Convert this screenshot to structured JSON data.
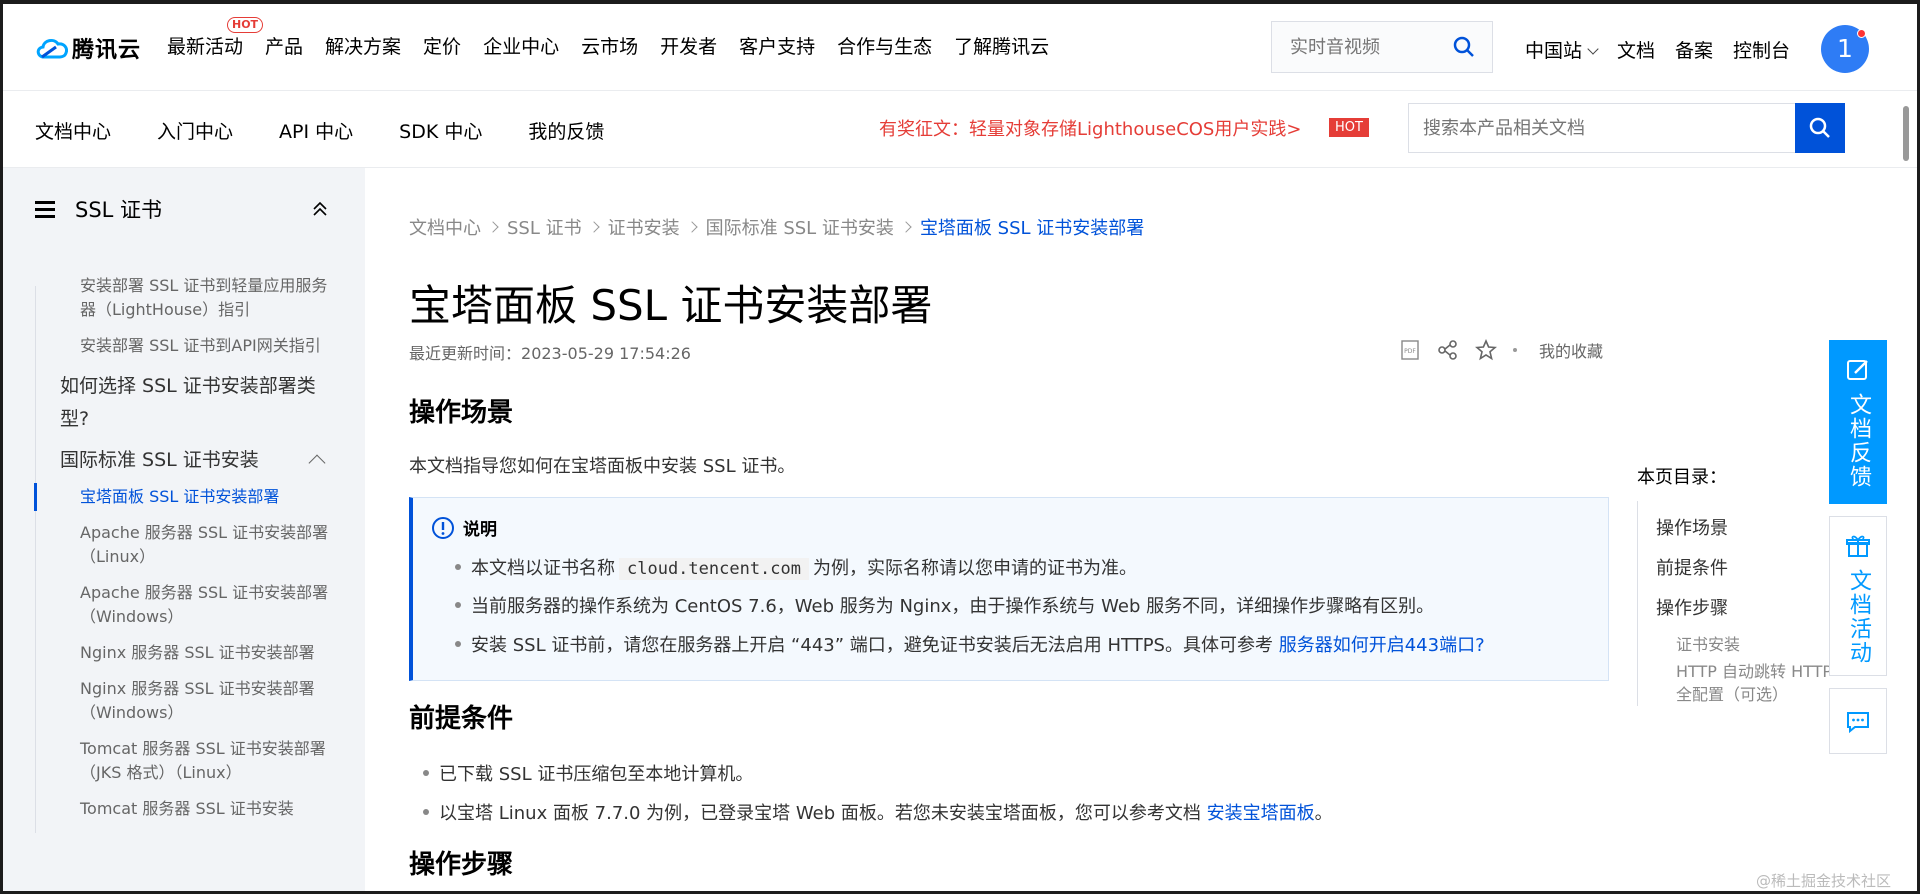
{
  "brand": {
    "name": "腾讯云",
    "color": "#0052d9",
    "logo_icon": "cloud-logo-icon"
  },
  "topnav": {
    "items": [
      "最新活动",
      "产品",
      "解决方案",
      "定价",
      "企业中心",
      "云市场",
      "开发者",
      "客户支持",
      "合作与生态",
      "了解腾讯云"
    ],
    "hot_badge": "HOT",
    "search_placeholder": "实时音视频",
    "right_items": [
      "中国站",
      "文档",
      "备案",
      "控制台"
    ],
    "avatar_text": "1"
  },
  "subnav": {
    "tabs": [
      "文档中心",
      "入门中心",
      "API 中心",
      "SDK 中心",
      "我的反馈"
    ],
    "promo_text": "有奖征文：轻量对象存储LighthouseCOS用户实践>",
    "promo_badge": "HOT",
    "search_placeholder": "搜索本产品相关文档"
  },
  "sidebar": {
    "title": "SSL 证书",
    "items": [
      {
        "label": "安装部署 SSL 证书到轻量应用服务器（LightHouse）指引",
        "level": 3
      },
      {
        "label": "安装部署 SSL 证书到API网关指引",
        "level": 3
      },
      {
        "label": "如何选择 SSL 证书安装部署类型?",
        "level": 2
      },
      {
        "label": "国际标准 SSL 证书安装",
        "level": 2
      },
      {
        "label": "宝塔面板 SSL 证书安装部署",
        "level": 3,
        "active": true
      },
      {
        "label": "Apache 服务器 SSL 证书安装部署（Linux）",
        "level": 3
      },
      {
        "label": "Apache 服务器 SSL 证书安装部署（Windows）",
        "level": 3
      },
      {
        "label": "Nginx 服务器 SSL 证书安装部署",
        "level": 3
      },
      {
        "label": "Nginx 服务器 SSL 证书安装部署（Windows）",
        "level": 3
      },
      {
        "label": "Tomcat 服务器 SSL 证书安装部署（JKS 格式）（Linux）",
        "level": 3
      },
      {
        "label": "Tomcat 服务器 SSL 证书安装",
        "level": 3
      }
    ]
  },
  "breadcrumb": [
    "文档中心",
    "SSL 证书",
    "证书安装",
    "国际标准 SSL 证书安装",
    "宝塔面板 SSL 证书安装部署"
  ],
  "article": {
    "title": "宝塔面板 SSL 证书安装部署",
    "updated_label": "最近更新时间：",
    "updated_time": "2023-05-29 17:54:26",
    "favorite_label": "我的收藏",
    "sec1_title": "操作场景",
    "sec1_text": "本文档指导您如何在宝塔面板中安装 SSL 证书。",
    "note_title": "说明",
    "note_b1_pre": "本文档以证书名称",
    "note_b1_code": "cloud.tencent.com",
    "note_b1_post": "为例，实际名称请以您申请的证书为准。",
    "note_b2": "当前服务器的操作系统为 CentOS 7.6，Web 服务为 Nginx，由于操作系统与 Web 服务不同，详细操作步骤略有区别。",
    "note_b3_pre": "安装 SSL 证书前，请您在服务器上开启 “443” 端口，避免证书安装后无法启用 HTTPS。具体可参考",
    "note_b3_link": "服务器如何开启443端口?",
    "sec2_title": "前提条件",
    "pre_b1": "已下载 SSL 证书压缩包至本地计算机。",
    "pre_b2_pre": "以宝塔 Linux 面板 7.7.0 为例，已登录宝塔 Web 面板。若您未安装宝塔面板，您可以参考文档",
    "pre_b2_link": "安装宝塔面板",
    "pre_b2_post": "。",
    "sec3_title": "操作步骤"
  },
  "toc": {
    "title": "本页目录：",
    "items": [
      "操作场景",
      "前提条件",
      "操作步骤"
    ],
    "sub_items": [
      "证书安装",
      "HTTP 自动跳转 HTTP",
      "全配置（可选）"
    ]
  },
  "float_tabs": {
    "feedback": "文档反馈",
    "activity": "文档活动"
  },
  "watermark": "@稀土掘金技术社区"
}
